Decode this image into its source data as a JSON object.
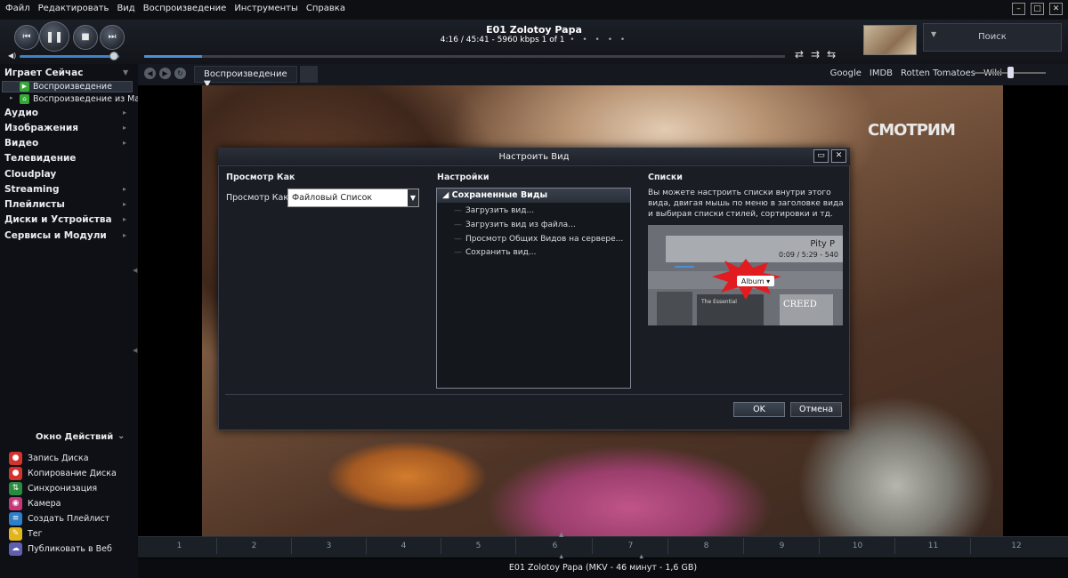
{
  "menu": [
    "Файл",
    "Редактировать",
    "Вид",
    "Воспроизведение",
    "Инструменты",
    "Справка"
  ],
  "player": {
    "track_title": "E01 Zolotoy Papa",
    "track_info": "4:16 / 45:41 - 5960 kbps   1 of 1",
    "track_dots": "• • • • •",
    "volume": 0.95,
    "progress": 0.09
  },
  "search": {
    "label": "Поиск"
  },
  "toolbar": {
    "view_label": "Воспроизведение",
    "links": [
      "Google",
      "IMDB",
      "Rotten Tomatoes",
      "Wiki"
    ]
  },
  "sidebar": {
    "now_playing": "Играет Сейчас",
    "sub1": "Воспроизведение",
    "sub2": "Воспроизведение из Ма...",
    "items": [
      "Аудио",
      "Изображения",
      "Видео",
      "Телевидение",
      "Cloudplay",
      "Streaming",
      "Плейлисты",
      "Диски и Устройства",
      "Сервисы и Модули"
    ]
  },
  "actions": {
    "title": "Окно Действий",
    "items": [
      "Запись Диска",
      "Копирование Диска",
      "Синхронизация",
      "Камера",
      "Создать Плейлист",
      "Тег",
      "Публиковать в Веб"
    ]
  },
  "video": {
    "watermark": "СМОТРИМ"
  },
  "chapters": [
    "1",
    "2",
    "3",
    "4",
    "5",
    "6",
    "7",
    "8",
    "9",
    "10",
    "11",
    "12"
  ],
  "status": "E01 Zolotoy Papa (MKV - 46 минут - 1,6 GB)",
  "dialog": {
    "title": "Настроить Вид",
    "col1": "Просмотр Как",
    "view_as_label": "Просмотр Как:",
    "view_as_value": "Файловый Список",
    "col2": "Настройки",
    "tree_head": "Сохраненные Виды",
    "tree_items": [
      "Загрузить вид...",
      "Загрузить вид из файла...",
      "Просмотр Общих Видов на сервере...",
      "Сохранить вид..."
    ],
    "col3": "Списки",
    "lists_text": "Вы можете настроить списки внутри этого вида, двигая мышь по меню в заголовке вида и выбирая списки стилей, сортировки и тд.",
    "img_title": "Pity P",
    "img_time": "0:09 / 5:29 - 540",
    "img_album": "Album ▾",
    "img_cd1": "The Essential",
    "img_cd2": "CREED",
    "ok": "OK",
    "cancel": "Отмена"
  }
}
